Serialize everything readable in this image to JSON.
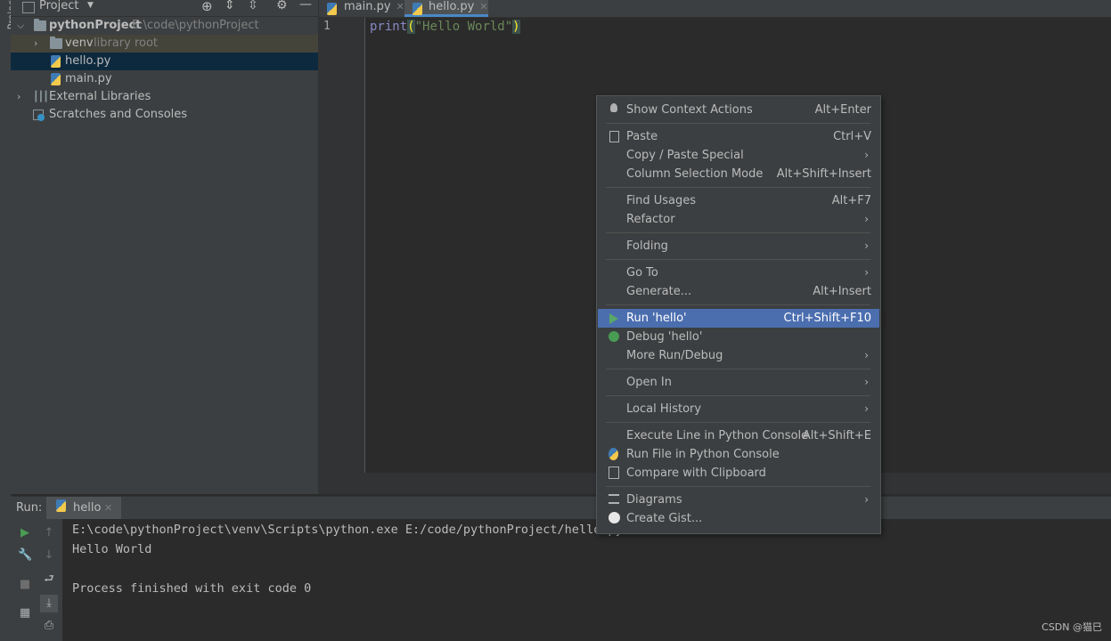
{
  "left_stripe": {
    "label": "Project"
  },
  "project_panel": {
    "header_label": "Project",
    "tree": [
      {
        "label": "pythonProject",
        "hint": "E:\\code\\pythonProject"
      },
      {
        "label": "venv",
        "hint": "library root"
      },
      {
        "label": "hello.py"
      },
      {
        "label": "main.py"
      },
      {
        "label": "External Libraries"
      },
      {
        "label": "Scratches and Consoles"
      }
    ]
  },
  "editor": {
    "tabs": [
      {
        "label": "main.py"
      },
      {
        "label": "hello.py"
      }
    ],
    "line_number": "1",
    "code": {
      "fn": "print",
      "open": "(",
      "string": "\"Hello World\"",
      "close": ")"
    }
  },
  "run_panel": {
    "label": "Run:",
    "tab_label": "hello",
    "console": [
      "E:\\code\\pythonProject\\venv\\Scripts\\python.exe E:/code/pythonProject/hello.py",
      "Hello World",
      "",
      "Process finished with exit code 0"
    ]
  },
  "context_menu": {
    "items": [
      {
        "label": "Show Context Actions",
        "shortcut": "Alt+Enter"
      },
      {
        "label": "Paste",
        "shortcut": "Ctrl+V"
      },
      {
        "label": "Copy / Paste Special"
      },
      {
        "label": "Column Selection Mode",
        "shortcut": "Alt+Shift+Insert"
      },
      {
        "label": "Find Usages",
        "shortcut": "Alt+F7"
      },
      {
        "label": "Refactor"
      },
      {
        "label": "Folding"
      },
      {
        "label": "Go To"
      },
      {
        "label": "Generate...",
        "shortcut": "Alt+Insert"
      },
      {
        "label": "Run 'hello'",
        "shortcut": "Ctrl+Shift+F10"
      },
      {
        "label": "Debug 'hello'"
      },
      {
        "label": "More Run/Debug"
      },
      {
        "label": "Open In"
      },
      {
        "label": "Local History"
      },
      {
        "label": "Execute Line in Python Console",
        "shortcut": "Alt+Shift+E"
      },
      {
        "label": "Run File in Python Console"
      },
      {
        "label": "Compare with Clipboard"
      },
      {
        "label": "Diagrams"
      },
      {
        "label": "Create Gist..."
      }
    ]
  },
  "watermark": "CSDN @猫巳",
  "colors": {
    "accent_selection": "#4b6eaf",
    "string": "#6a8759",
    "keyword_fn": "#8888c6",
    "brace_highlight": "#ffef28"
  }
}
